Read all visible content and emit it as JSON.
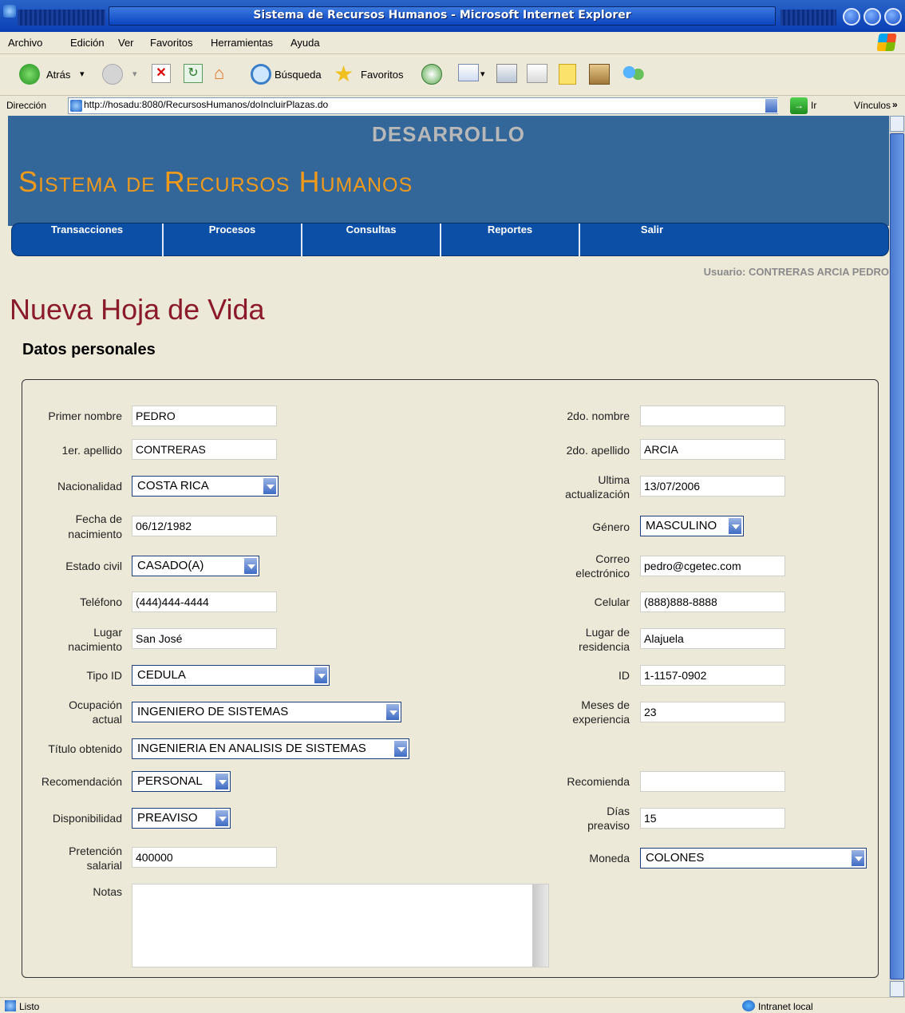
{
  "window": {
    "title": "Sistema de Recursos Humanos - Microsoft Internet Explorer"
  },
  "menu": [
    "Archivo",
    "Edición",
    "Ver",
    "Favoritos",
    "Herramientas",
    "Ayuda"
  ],
  "toolbar": {
    "back": "Atrás",
    "search": "Búsqueda",
    "favorites": "Favoritos"
  },
  "address": {
    "label": "Dirección",
    "url": "http://hosadu:8080/RecursosHumanos/doIncluirPlazas.do",
    "go": "Ir",
    "links": "Vínculos"
  },
  "banner": {
    "env": "DESARROLLO",
    "system": "Sistema de Recursos Humanos"
  },
  "nav": [
    "Transacciones",
    "Procesos",
    "Consultas",
    "Reportes",
    "Salir"
  ],
  "user": "Usuario: CONTRERAS ARCIA PEDRO",
  "page_title": "Nueva Hoja de Vida",
  "section_title": "Datos personales",
  "form": {
    "primer_nombre": {
      "label": "Primer nombre",
      "value": "PEDRO"
    },
    "segundo_nombre": {
      "label": "2do. nombre",
      "value": ""
    },
    "primer_apellido": {
      "label": "1er. apellido",
      "value": "CONTRERAS"
    },
    "segundo_apellido": {
      "label": "2do. apellido",
      "value": "ARCIA"
    },
    "nacionalidad": {
      "label": "Nacionalidad",
      "value": "COSTA RICA"
    },
    "ultima_actualizacion": {
      "label1": "Ultima",
      "label2": "actualización",
      "value": "13/07/2006"
    },
    "fecha_nacimiento": {
      "label1": "Fecha de",
      "label2": "nacimiento",
      "value": "06/12/1982"
    },
    "genero": {
      "label": "Género",
      "value": "MASCULINO"
    },
    "estado_civil": {
      "label": "Estado civil",
      "value": "CASADO(A)"
    },
    "correo": {
      "label1": "Correo",
      "label2": "electrónico",
      "value": "pedro@cgetec.com"
    },
    "telefono": {
      "label": "Teléfono",
      "value": "(444)444-4444"
    },
    "celular": {
      "label": "Celular",
      "value": "(888)888-8888"
    },
    "lugar_nacimiento": {
      "label1": "Lugar",
      "label2": "nacimiento",
      "value": "San José"
    },
    "lugar_residencia": {
      "label1": "Lugar de",
      "label2": "residencia",
      "value": "Alajuela"
    },
    "tipo_id": {
      "label": "Tipo ID",
      "value": "CEDULA"
    },
    "id": {
      "label": "ID",
      "value": "1-1157-0902"
    },
    "ocupacion": {
      "label1": "Ocupación",
      "label2": "actual",
      "value": "INGENIERO DE SISTEMAS"
    },
    "meses_experiencia": {
      "label1": "Meses de",
      "label2": "experiencia",
      "value": "23"
    },
    "titulo": {
      "label": "Título obtenido",
      "value": "INGENIERIA EN ANALISIS DE SISTEMAS"
    },
    "recomendacion": {
      "label": "Recomendación",
      "value": "PERSONAL"
    },
    "recomienda": {
      "label": "Recomienda",
      "value": ""
    },
    "disponibilidad": {
      "label": "Disponibilidad",
      "value": "PREAVISO"
    },
    "dias_preaviso": {
      "label1": "Días",
      "label2": "preaviso",
      "value": "15"
    },
    "pretencion": {
      "label1": "Pretención",
      "label2": "salarial",
      "value": "400000"
    },
    "moneda": {
      "label": "Moneda",
      "value": "COLONES"
    },
    "notas": {
      "label": "Notas",
      "value": ""
    }
  },
  "status": {
    "left": "Listo",
    "zone": "Intranet local"
  },
  "colors": {
    "banner": "#336699",
    "nav": "#0c4fa6",
    "system_name": "#f09a1c",
    "page_title": "#8b1a2a"
  }
}
